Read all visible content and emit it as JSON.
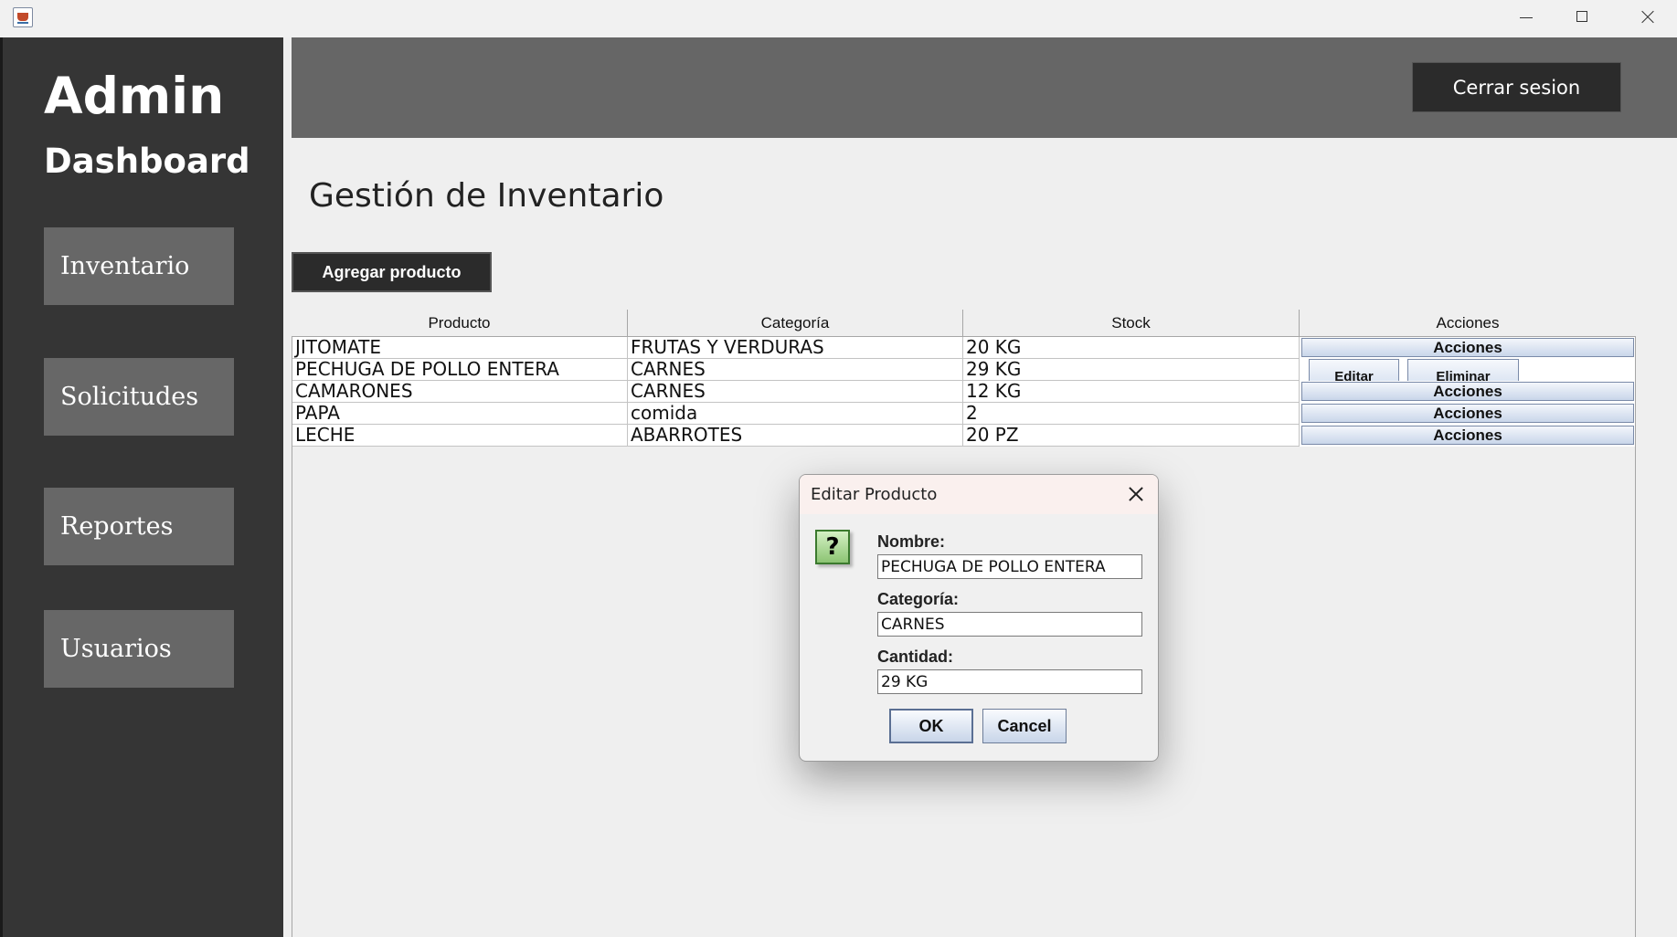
{
  "window": {
    "icon": "java-cup-icon",
    "controls": [
      "minimize-icon",
      "maximize-icon",
      "close-icon"
    ]
  },
  "sidebar": {
    "brand_line1": "Admin",
    "brand_line2": "Dashboard",
    "items": [
      {
        "label": "Inventario"
      },
      {
        "label": "Solicitudes"
      },
      {
        "label": "Reportes"
      },
      {
        "label": "Usuarios"
      }
    ]
  },
  "header": {
    "logout_label": "Cerrar sesion"
  },
  "main": {
    "title": "Gestión de Inventario",
    "add_button_label": "Agregar producto",
    "table": {
      "columns": [
        "Producto",
        "Categoría",
        "Stock",
        "Acciones"
      ],
      "rows": [
        {
          "producto": "JITOMATE",
          "categoria": "FRUTAS Y VERDURAS",
          "stock": "20 KG",
          "accion": "Acciones"
        },
        {
          "producto": "PECHUGA DE POLLO ENTERA",
          "categoria": "CARNES",
          "stock": "29 KG",
          "accion_edit": "Editar",
          "accion_delete": "Eliminar"
        },
        {
          "producto": "CAMARONES",
          "categoria": "CARNES",
          "stock": "12 KG",
          "accion": "Acciones"
        },
        {
          "producto": "PAPA",
          "categoria": "comida",
          "stock": "2",
          "accion": "Acciones"
        },
        {
          "producto": "LECHE",
          "categoria": "ABARROTES",
          "stock": "20 PZ",
          "accion": "Acciones"
        }
      ]
    }
  },
  "dialog": {
    "title": "Editar Producto",
    "icon_glyph": "?",
    "fields": {
      "nombre_label": "Nombre:",
      "nombre_value": "PECHUGA DE POLLO ENTERA",
      "categoria_label": "Categoría:",
      "categoria_value": "CARNES",
      "cantidad_label": "Cantidad:",
      "cantidad_value": "29 KG"
    },
    "ok_label": "OK",
    "cancel_label": "Cancel"
  }
}
